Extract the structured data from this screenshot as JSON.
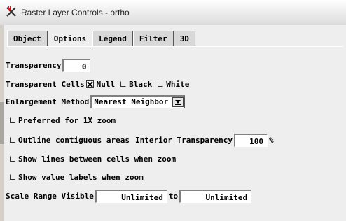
{
  "window": {
    "title": "Raster Layer Controls - ortho",
    "icon": "tntmips-app-icon",
    "accent_color": "#cc2222"
  },
  "tabs": [
    {
      "label": "Object",
      "active": false
    },
    {
      "label": "Options",
      "active": true
    },
    {
      "label": "Legend",
      "active": false
    },
    {
      "label": "Filter",
      "active": false
    },
    {
      "label": "3D",
      "active": false
    }
  ],
  "transparency": {
    "label": "Transparency",
    "value": "0"
  },
  "transparent_cells": {
    "label": "Transparent Cells",
    "null_label": "Null",
    "null_checked": true,
    "black_label": "Black",
    "black_checked": false,
    "white_label": "White",
    "white_checked": false
  },
  "enlargement": {
    "label": "Enlargement Method",
    "selected": "Nearest Neighbor"
  },
  "preferred_1x": {
    "label": "Preferred for 1X zoom",
    "checked": false
  },
  "outline": {
    "label": "Outline contiguous areas",
    "checked": false,
    "interior_label": "Interior Transparency",
    "interior_value": "100",
    "unit": "%"
  },
  "show_lines": {
    "label": "Show lines between cells when zoom",
    "checked": false
  },
  "show_values": {
    "label": "Show value labels when zoom",
    "checked": false
  },
  "scale_range": {
    "label": "Scale Range Visible",
    "min": "Unlimited",
    "to_label": "to",
    "max": "Unlimited"
  }
}
